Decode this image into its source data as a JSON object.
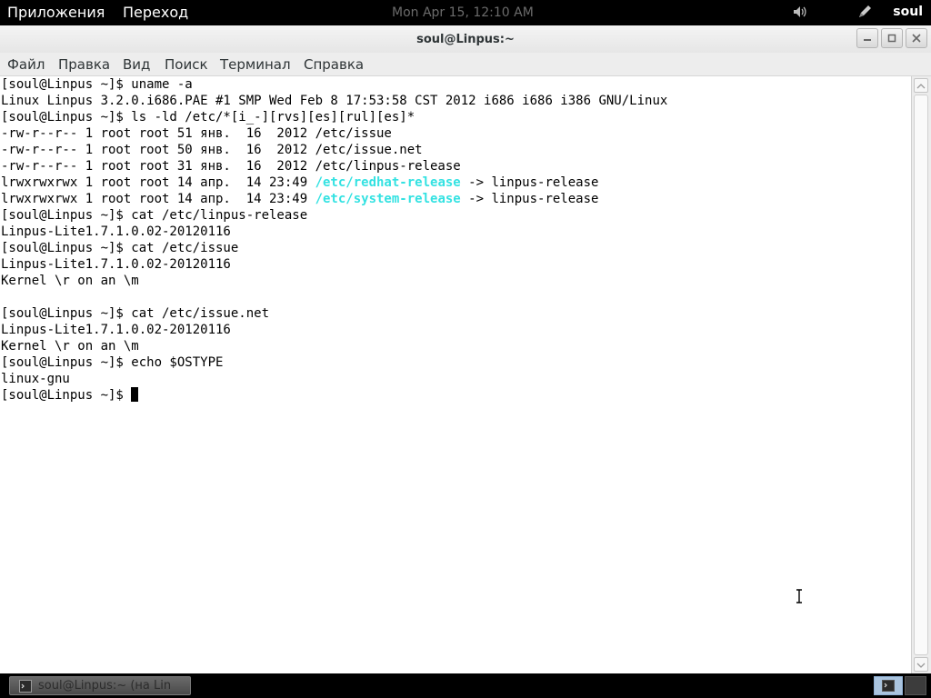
{
  "top_panel": {
    "applications": "Приложения",
    "places": "Переход",
    "clock": "Mon Apr 15, 12:10 AM",
    "user": "soul",
    "volume_icon": "speaker-icon",
    "pen_icon": "pen-icon"
  },
  "window": {
    "title": "soul@Linpus:~",
    "buttons": [
      "minimize",
      "maximize",
      "close"
    ]
  },
  "menubar": {
    "file": "Файл",
    "edit": "Правка",
    "view": "Вид",
    "search": "Поиск",
    "terminal": "Терминал",
    "help": "Справка"
  },
  "terminal": {
    "lines": [
      {
        "text": "[soul@Linpus ~]$ uname -a"
      },
      {
        "text": "Linux Linpus 3.2.0.i686.PAE #1 SMP Wed Feb 8 17:53:58 CST 2012 i686 i686 i386 GNU/Linux"
      },
      {
        "text": "[soul@Linpus ~]$ ls -ld /etc/*[i_-][rvs][es][rul][es]*"
      },
      {
        "text": "-rw-r--r-- 1 root root 51 янв.  16  2012 /etc/issue"
      },
      {
        "text": "-rw-r--r-- 1 root root 50 янв.  16  2012 /etc/issue.net"
      },
      {
        "text": "-rw-r--r-- 1 root root 31 янв.  16  2012 /etc/linpus-release"
      },
      {
        "prefix": "lrwxrwxrwx 1 root root 14 апр.  14 23:49 ",
        "link": "/etc/redhat-release",
        "suffix": " -> linpus-release"
      },
      {
        "prefix": "lrwxrwxrwx 1 root root 14 апр.  14 23:49 ",
        "link": "/etc/system-release",
        "suffix": " -> linpus-release"
      },
      {
        "text": "[soul@Linpus ~]$ cat /etc/linpus-release"
      },
      {
        "text": "Linpus-Lite1.7.1.0.02-20120116"
      },
      {
        "text": "[soul@Linpus ~]$ cat /etc/issue"
      },
      {
        "text": "Linpus-Lite1.7.1.0.02-20120116"
      },
      {
        "text": "Kernel \\r on an \\m"
      },
      {
        "text": ""
      },
      {
        "text": "[soul@Linpus ~]$ cat /etc/issue.net"
      },
      {
        "text": "Linpus-Lite1.7.1.0.02-20120116"
      },
      {
        "text": "Kernel \\r on an \\m"
      },
      {
        "text": "[soul@Linpus ~]$ echo $OSTYPE"
      },
      {
        "text": "linux-gnu"
      },
      {
        "text": "[soul@Linpus ~]$ ",
        "cursor": true
      }
    ],
    "link_color": "#34e2e2"
  },
  "bottom_panel": {
    "task_label": "soul@Linpus:~ (на Lin",
    "task_icon": "terminal-icon"
  }
}
